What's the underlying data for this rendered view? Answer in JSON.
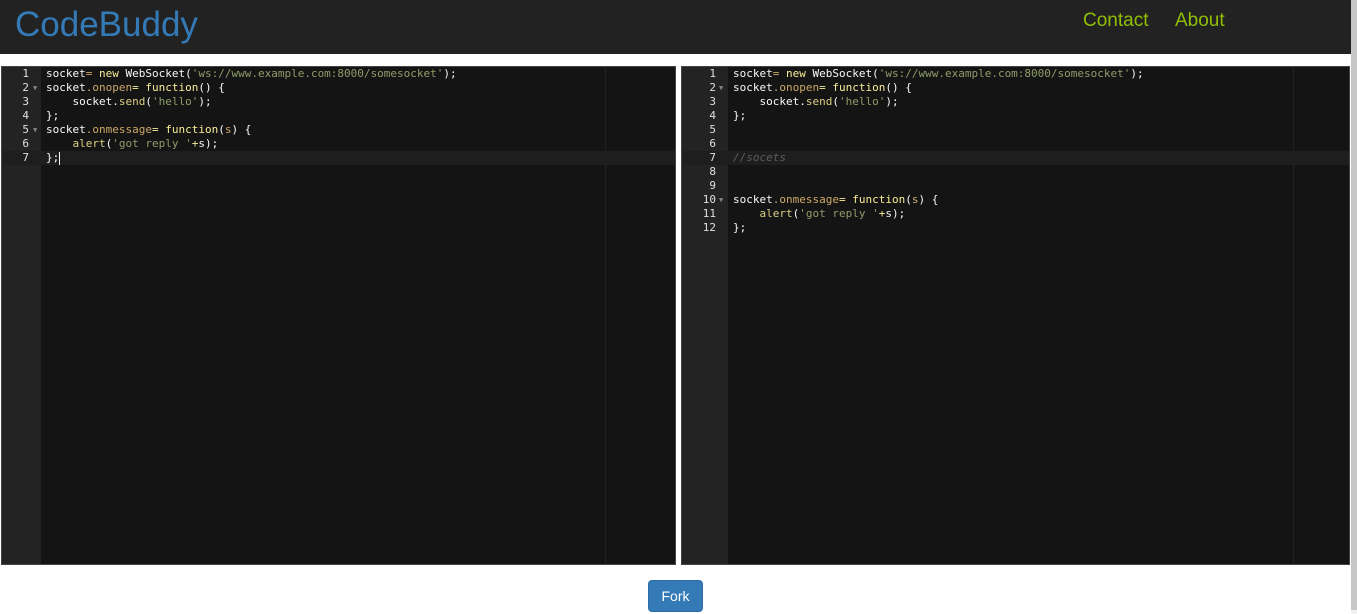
{
  "navbar": {
    "brand": "CodeBuddy",
    "links": [
      {
        "label": "Contact"
      },
      {
        "label": "About"
      }
    ],
    "link_color": "#8fbf00",
    "brand_color": "#337ab7"
  },
  "editor_left": {
    "lines": [
      {
        "num": "1",
        "tokens": [
          [
            "plain",
            "socket"
          ],
          [
            "prop",
            "="
          ],
          [
            "plain",
            " "
          ],
          [
            "kw",
            "new"
          ],
          [
            "plain",
            " WebSocket("
          ],
          [
            "str",
            "'ws://www.example.com:8000/somesocket'"
          ],
          [
            "plain",
            ");"
          ]
        ]
      },
      {
        "num": "2",
        "fold": true,
        "tokens": [
          [
            "plain",
            "socket"
          ],
          [
            "prop",
            ".onopen"
          ],
          [
            "kw",
            "="
          ],
          [
            "plain",
            " "
          ],
          [
            "kw",
            "function"
          ],
          [
            "plain",
            "() {"
          ]
        ]
      },
      {
        "num": "3",
        "tokens": [
          [
            "plain",
            "    socket."
          ],
          [
            "fn",
            "send"
          ],
          [
            "plain",
            "("
          ],
          [
            "str",
            "'hello'"
          ],
          [
            "plain",
            ");"
          ]
        ]
      },
      {
        "num": "4",
        "tokens": [
          [
            "plain",
            "};"
          ]
        ]
      },
      {
        "num": "5",
        "fold": true,
        "tokens": [
          [
            "plain",
            "socket"
          ],
          [
            "prop",
            ".onmessage"
          ],
          [
            "kw",
            "="
          ],
          [
            "plain",
            " "
          ],
          [
            "kw",
            "function"
          ],
          [
            "plain",
            "("
          ],
          [
            "prop",
            "s"
          ],
          [
            "plain",
            ") {"
          ]
        ]
      },
      {
        "num": "6",
        "tokens": [
          [
            "plain",
            "    "
          ],
          [
            "fn",
            "alert"
          ],
          [
            "plain",
            "("
          ],
          [
            "str",
            "'got reply '"
          ],
          [
            "kw",
            "+"
          ],
          [
            "plain",
            "s);"
          ]
        ]
      },
      {
        "num": "7",
        "active": true,
        "cursor": true,
        "tokens": [
          [
            "plain",
            "};"
          ]
        ]
      }
    ]
  },
  "editor_right": {
    "lines": [
      {
        "num": "1",
        "tokens": [
          [
            "plain",
            "socket"
          ],
          [
            "prop",
            "="
          ],
          [
            "plain",
            " "
          ],
          [
            "kw",
            "new"
          ],
          [
            "plain",
            " WebSocket("
          ],
          [
            "str",
            "'ws://www.example.com:8000/somesocket'"
          ],
          [
            "plain",
            ");"
          ]
        ]
      },
      {
        "num": "2",
        "fold": true,
        "tokens": [
          [
            "plain",
            "socket"
          ],
          [
            "prop",
            ".onopen"
          ],
          [
            "kw",
            "="
          ],
          [
            "plain",
            " "
          ],
          [
            "kw",
            "function"
          ],
          [
            "plain",
            "() {"
          ]
        ]
      },
      {
        "num": "3",
        "tokens": [
          [
            "plain",
            "    socket."
          ],
          [
            "fn",
            "send"
          ],
          [
            "plain",
            "("
          ],
          [
            "str",
            "'hello'"
          ],
          [
            "plain",
            ");"
          ]
        ]
      },
      {
        "num": "4",
        "tokens": [
          [
            "plain",
            "};"
          ]
        ]
      },
      {
        "num": "5",
        "tokens": []
      },
      {
        "num": "6",
        "tokens": []
      },
      {
        "num": "7",
        "active": true,
        "tokens": [
          [
            "cm",
            "//socets"
          ]
        ]
      },
      {
        "num": "8",
        "tokens": []
      },
      {
        "num": "9",
        "tokens": []
      },
      {
        "num": "10",
        "fold": true,
        "tokens": [
          [
            "plain",
            "socket"
          ],
          [
            "prop",
            ".onmessage"
          ],
          [
            "kw",
            "="
          ],
          [
            "plain",
            " "
          ],
          [
            "kw",
            "function"
          ],
          [
            "plain",
            "("
          ],
          [
            "prop",
            "s"
          ],
          [
            "plain",
            ") {"
          ]
        ]
      },
      {
        "num": "11",
        "tokens": [
          [
            "plain",
            "    "
          ],
          [
            "fn",
            "alert"
          ],
          [
            "plain",
            "("
          ],
          [
            "str",
            "'got reply '"
          ],
          [
            "kw",
            "+"
          ],
          [
            "plain",
            "s);"
          ]
        ]
      },
      {
        "num": "12",
        "tokens": [
          [
            "plain",
            "};"
          ]
        ]
      }
    ]
  },
  "fork_button": {
    "label": "Fork"
  }
}
